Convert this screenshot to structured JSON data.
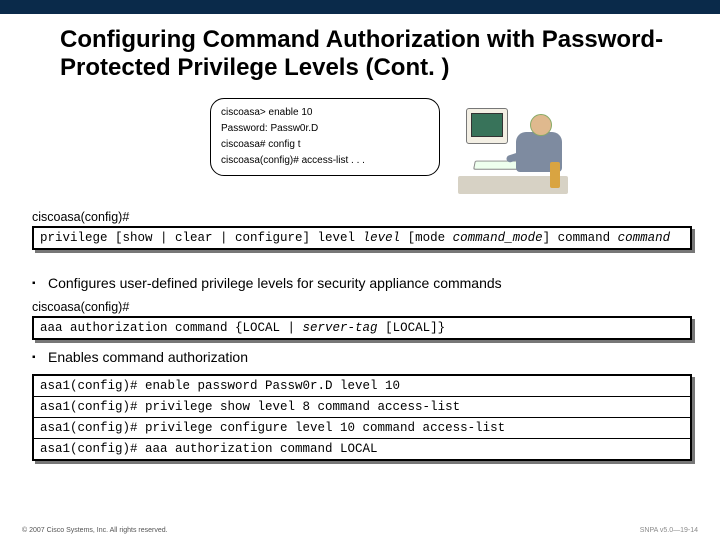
{
  "title": "Configuring Command Authorization with Password-Protected Privilege Levels (Cont. )",
  "callout": {
    "l1": "ciscoasa> enable 10",
    "l2": "Password: Passw0r.D",
    "l3": "ciscoasa# config t",
    "l4": "ciscoasa(config)# access-list . . ."
  },
  "prompt1": "ciscoasa(config)#",
  "syntax1": {
    "p1": "privilege [show | clear | configure] level ",
    "i1": "level",
    "p2": " [mode ",
    "i2": "command_mode",
    "p3": "] command ",
    "i3": "command"
  },
  "bullet1": "Configures user-defined privilege levels for security appliance commands",
  "prompt2": "ciscoasa(config)#",
  "syntax2": {
    "p1": "aaa authorization command {LOCAL | ",
    "i1": "server-tag",
    "p2": " [LOCAL]}"
  },
  "bullet2": "Enables command authorization",
  "examples": {
    "r1": "asa1(config)# enable password Passw0r.D level 10",
    "r2": "asa1(config)# privilege show level 8 command access-list",
    "r3": "asa1(config)# privilege configure level 10 command access-list",
    "r4": "asa1(config)# aaa authorization command LOCAL"
  },
  "footer": {
    "left": "© 2007 Cisco Systems, Inc. All rights reserved.",
    "right": "SNPA v5.0—19-14"
  }
}
